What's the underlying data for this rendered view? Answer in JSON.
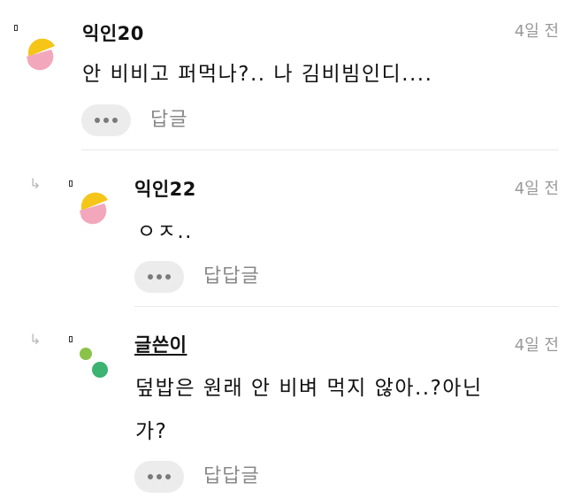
{
  "comments": [
    {
      "nickname": "익인20",
      "time": "4일 전",
      "text": "안 비비고 퍼먹나?.. 나 김비빔인디....",
      "more_icon": "more-dots-icon",
      "reply_label": "답글",
      "avatar_colors": [
        "#f5c518",
        "#f2a7bd"
      ]
    },
    {
      "nickname": "익인22",
      "time": "4일 전",
      "text": "ㅇㅈ..",
      "more_icon": "more-dots-icon",
      "reply_label": "답답글",
      "avatar_colors": [
        "#f5c518",
        "#f2a7bd"
      ]
    },
    {
      "nickname": "글쓴이",
      "time": "4일 전",
      "text_line1": "덮밥은 원래 안 비벼 먹지 않아..?아닌",
      "text_line2": "가?",
      "more_icon": "more-dots-icon",
      "reply_label": "답답글",
      "avatar_colors": [
        "#8bc34a",
        "#3cb371"
      ]
    }
  ]
}
